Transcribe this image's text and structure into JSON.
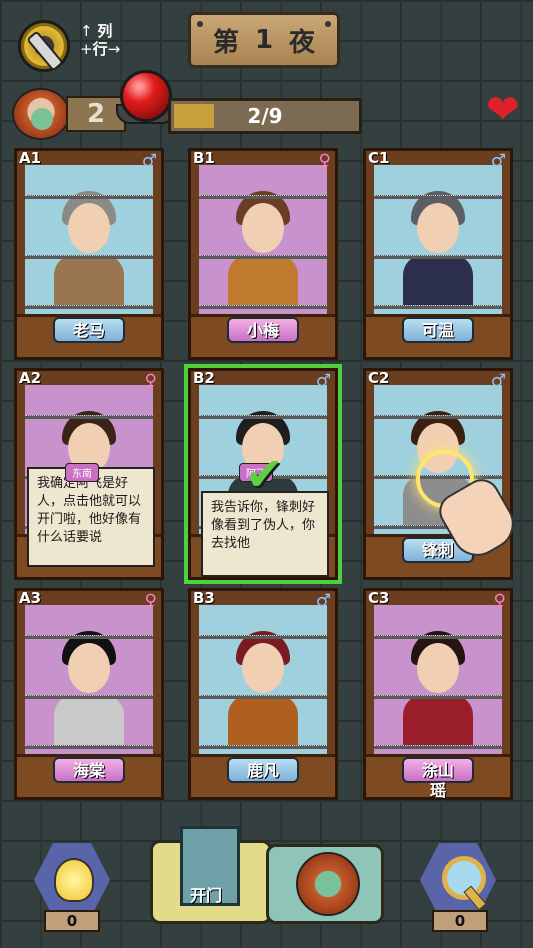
{
  "header": {
    "axis_hint_col": "列",
    "axis_hint_row": "行",
    "night_prefix": "第",
    "night_number": "1",
    "night_suffix": "夜",
    "lives_remaining": "2",
    "progress_text": "2/9",
    "progress_fraction": 0.22
  },
  "colors": {
    "brick": "#34403f",
    "wood": "#6a3e1e",
    "pink_card": "#c893cc",
    "blue_card": "#9fd0de",
    "highlight_green": "#4ed13b",
    "heart": "#e0212b"
  },
  "cards": [
    {
      "coord": "A1",
      "gender": "♂",
      "name": "老马"
    },
    {
      "coord": "B1",
      "gender": "♀",
      "name": "小梅"
    },
    {
      "coord": "C1",
      "gender": "♂",
      "name": "可温"
    },
    {
      "coord": "A2",
      "gender": "♀",
      "name": "东南",
      "speech": "我确定阿飞是好人，点击他就可以开门啦，他好像有什么话要说"
    },
    {
      "coord": "B2",
      "gender": "♂",
      "name": "阿飞",
      "speech": "我告诉你，锋刺好像看到了伪人，你去找他"
    },
    {
      "coord": "C2",
      "gender": "♂",
      "name": "锋刺"
    },
    {
      "coord": "A3",
      "gender": "♀",
      "name": "海棠"
    },
    {
      "coord": "B3",
      "gender": "♂",
      "name": "鹿凡"
    },
    {
      "coord": "C3",
      "gender": "♀",
      "name": "涂山瑶"
    }
  ],
  "bottom": {
    "hint_count": "0",
    "open_door_label": "开门",
    "magnifier_count": "0"
  },
  "icons": {
    "settings": "gear-icon",
    "alarm": "red-button-icon",
    "lives": "heart-icon",
    "hint": "lightbulb-icon",
    "door": "door-icon",
    "magnifier": "magnifier-icon"
  }
}
